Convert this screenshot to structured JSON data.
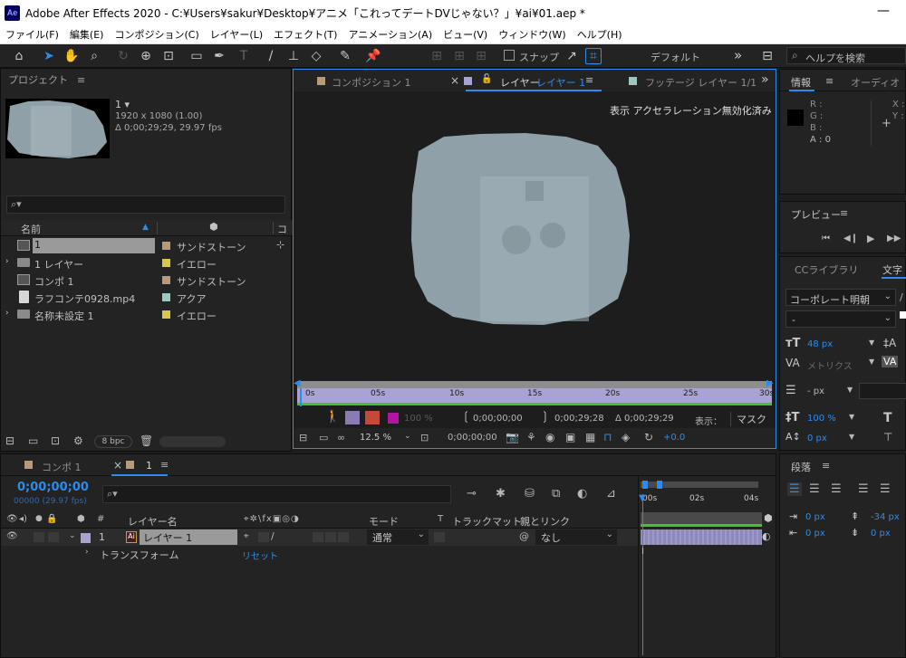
{
  "window": {
    "title": "Adobe After Effects 2020 - C:¥Users¥sakur¥Desktop¥アニメ「これってデートDVじゃない？」¥ai¥01.aep *",
    "app_icon": "Ae",
    "controls": "—",
    "close": "✕"
  },
  "menu": [
    "ファイル(F)",
    "編集(E)",
    "コンポジション(C)",
    "レイヤー(L)",
    "エフェクト(T)",
    "アニメーション(A)",
    "ビュー(V)",
    "ウィンドウ(W)",
    "ヘルプ(H)"
  ],
  "toolbar": {
    "snap_label": "スナップ",
    "workspace": "デフォルト",
    "more": "»",
    "search_placeholder": "ヘルプを検索"
  },
  "project": {
    "title": "プロジェクト",
    "menu_icon": "≡",
    "thumb_name": "1 ▾",
    "thumb_dims": "1920 x 1080 (1.00)",
    "thumb_duration": "Δ 0;00;29;29, 29.97 fps",
    "search_icon": "⌕▾",
    "columns": {
      "name": "名前",
      "label_icon": "tag-icon",
      "type": "コ"
    },
    "items": [
      {
        "name": "1",
        "label": "サンドストーン",
        "color": "#b89a78"
      },
      {
        "name": "1 レイヤー",
        "label": "イエロー",
        "color": "#d7c74d"
      },
      {
        "name": "コンポ 1",
        "label": "サンドストーン",
        "color": "#b89a78"
      },
      {
        "name": "ラフコンテ0928.mp4",
        "label": "アクア",
        "color": "#9fc7c1"
      },
      {
        "name": "名称未設定 1",
        "label": "イエロー",
        "color": "#d7c74d"
      }
    ],
    "bpc": "8 bpc",
    "trash": "🗑"
  },
  "viewer": {
    "tabs": {
      "comp": "コンポジション 1",
      "layer_prefix": "レイヤー",
      "layer": "レイヤー 1",
      "footage": "フッテージ レイヤー 1/1",
      "close": "×",
      "expand": "»"
    },
    "notice": "表示 アクセラレーション無効化済み",
    "ruler": [
      "0s",
      "05s",
      "10s",
      "15s",
      "20s",
      "25s",
      "30s"
    ],
    "opacity": "100 %",
    "tc_in": "0;00;00;00",
    "tc_out": "0;00;29;28",
    "tc_dur": "Δ 0;00;29;29",
    "view_label": "表示：",
    "view_value": "マスク",
    "zoom": "12.5 %",
    "tc_current": "0;00;00;00",
    "exposure": "+0.0"
  },
  "info": {
    "tabs": [
      "情報",
      "オーディオ"
    ],
    "rgba": [
      "R :",
      "G :",
      "B :",
      "A :  0"
    ],
    "xy": [
      "X :",
      "Y :"
    ]
  },
  "preview": {
    "title": "プレビュー",
    "controls": [
      "⏮",
      "◀❙",
      "▶",
      "▶▶"
    ]
  },
  "character": {
    "tabs": [
      "CCライブラリ",
      "文字"
    ],
    "font": "コーポレート明朝",
    "style": "-",
    "size": "48 px",
    "kerning": "メトリクス",
    "leading": "- px",
    "vscale": "100 %",
    "baseline": "0 px"
  },
  "paragraph": {
    "title": "段落",
    "indent_left": "0 px",
    "indent_first": "0 px",
    "space_before": "-34 px",
    "space_after": "0 px"
  },
  "timeline": {
    "tabs": [
      "コンポ 1",
      "1"
    ],
    "timecode": "0;00;00;00",
    "frame": "00000 (29.97 fps)",
    "search_placeholder": "⌕▾",
    "columns": {
      "hash": "#",
      "name": "レイヤー名",
      "mode": "モード",
      "track": "トラックマット",
      "parent": "親とリンク",
      "t": "T"
    },
    "layer": {
      "num": "1",
      "name": "レイヤー 1",
      "mode": "通常",
      "parent": "なし"
    },
    "transform": "トランスフォーム",
    "reset": "リセット",
    "ruler": [
      "00s",
      "02s",
      "04s"
    ]
  },
  "colors": {
    "accent": "#2d8ceb",
    "mask": "#8fa0a8",
    "track": "#a8a3d6",
    "green": "#42c42c"
  }
}
